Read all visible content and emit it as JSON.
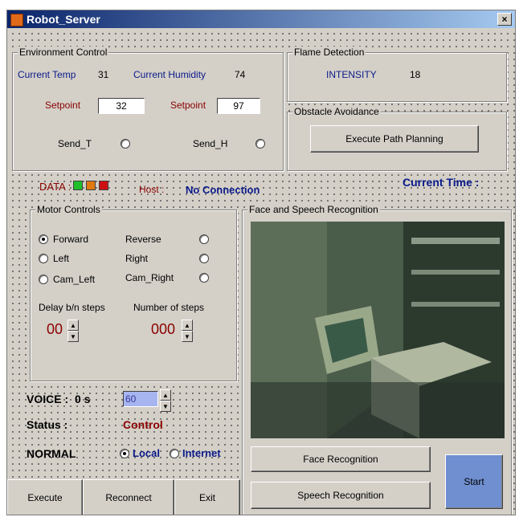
{
  "window": {
    "title": "Robot_Server",
    "close_label": "×"
  },
  "env": {
    "legend": "Environment Control",
    "temp_label": "Current Temp",
    "temp_value": "31",
    "hum_label": "Current Humidity",
    "hum_value": "74",
    "setpoint_label": "Setpoint",
    "setpoint_t": "32",
    "setpoint_h": "97",
    "send_t": "Send_T",
    "send_h": "Send_H"
  },
  "flame": {
    "legend": "Flame Detection",
    "label": "INTENSITY",
    "value": "18"
  },
  "obstacle": {
    "legend": "Obstacle Avoidance",
    "button": "Execute Path Planning"
  },
  "status_bar": {
    "data_label": "DATA :",
    "host_label": "Host :",
    "host_value": "No Connection",
    "current_time_label": "Current Time :",
    "indicator_colors": [
      "#1fbf2a",
      "#e07a10",
      "#d01010"
    ]
  },
  "motor": {
    "legend": "Motor Controls",
    "forward": "Forward",
    "reverse": "Reverse",
    "left": "Left",
    "right": "Right",
    "cam_left": "Cam_Left",
    "cam_right": "Cam_Right",
    "delay_label": "Delay b/n steps",
    "steps_label": "Number of steps",
    "delay_value": "00",
    "steps_value": "000"
  },
  "voice": {
    "label": "VOICE :",
    "value_text": "0 s",
    "spin_value": "60"
  },
  "status": {
    "label": "Status :",
    "value": "Control"
  },
  "mode": {
    "normal": "NORMAL",
    "local": "Local",
    "internet": "Internet"
  },
  "face": {
    "legend": "Face and Speech Recognition",
    "face_button": "Face Recognition",
    "speech_button": "Speech Recognition",
    "start_button": "Start"
  },
  "bottom": {
    "execute": "Execute",
    "reconnect": "Reconnect",
    "exit": "Exit"
  },
  "colors": {
    "accent_blue": "#0a1a8a",
    "accent_red": "#8a0000",
    "start_button": "#6f8fd0"
  }
}
